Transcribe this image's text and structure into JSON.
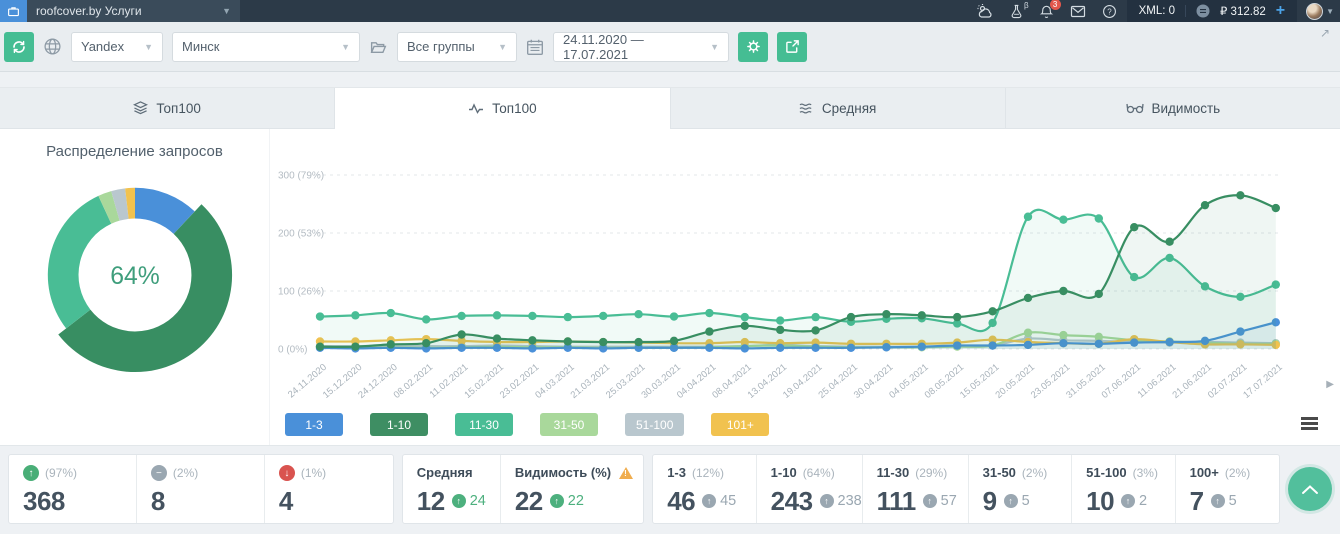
{
  "topbar": {
    "project": "roofcover.by Услуги",
    "bell_badge": "3",
    "xml_label": "XML: 0",
    "balance": "₽ 312.82",
    "plus": "+"
  },
  "toolbar": {
    "engine": "Yandex",
    "region": "Минск",
    "group": "Все группы",
    "date_range": "24.11.2020 — 17.07.2021"
  },
  "tabs": [
    {
      "label": "Топ100"
    },
    {
      "label": "Топ100",
      "active": true
    },
    {
      "label": "Средняя"
    },
    {
      "label": "Видимость"
    }
  ],
  "colors": {
    "blue": "#4a90d9",
    "darkgreen": "#388e62",
    "teal": "#49bd95",
    "lightgreen": "#a9d89b",
    "gray": "#b9c7ce",
    "yellow": "#f1c24f"
  },
  "legend": {
    "items": [
      {
        "label": "1-3",
        "color": "#4a90d9"
      },
      {
        "label": "1-10",
        "color": "#3e8e63"
      },
      {
        "label": "11-30",
        "color": "#49bd95"
      },
      {
        "label": "31-50",
        "color": "#a9d89b"
      },
      {
        "label": "51-100",
        "color": "#b9c7ce"
      },
      {
        "label": "101+",
        "color": "#f1c24f"
      }
    ]
  },
  "chart_data": [
    {
      "type": "pie",
      "title": "Распределение запросов",
      "center_label": "64%",
      "center_color": "#3f9e7c",
      "segments": [
        {
          "label": "1-3",
          "pct": 12.0,
          "color": "#4a90d9",
          "exploded": false
        },
        {
          "label": "1-10",
          "pct": 52.5,
          "color": "#388e62",
          "exploded": true
        },
        {
          "label": "11-30",
          "pct": 28.6,
          "color": "#49bd95",
          "exploded": false
        },
        {
          "label": "31-50",
          "pct": 2.5,
          "color": "#a9d89b",
          "exploded": false
        },
        {
          "label": "51-100",
          "pct": 2.6,
          "color": "#b9c7ce",
          "exploded": false
        },
        {
          "label": "101+",
          "pct": 1.8,
          "color": "#f1c24f",
          "exploded": false
        }
      ]
    },
    {
      "type": "line",
      "ylim": [
        0,
        300
      ],
      "grid": true,
      "yticks": [
        {
          "v": 0,
          "label": "0 (0%)"
        },
        {
          "v": 100,
          "label": "100 (26%)"
        },
        {
          "v": 200,
          "label": "200 (53%)"
        },
        {
          "v": 300,
          "label": "300 (79%)"
        }
      ],
      "x": [
        "24.11.2020",
        "15.12.2020",
        "24.12.2020",
        "08.02.2021",
        "11.02.2021",
        "15.02.2021",
        "23.02.2021",
        "04.03.2021",
        "21.03.2021",
        "25.03.2021",
        "30.03.2021",
        "04.04.2021",
        "08.04.2021",
        "13.04.2021",
        "19.04.2021",
        "25.04.2021",
        "30.04.2021",
        "04.05.2021",
        "08.05.2021",
        "15.05.2021",
        "20.05.2021",
        "23.05.2021",
        "31.05.2021",
        "07.06.2021",
        "11.06.2021",
        "21.06.2021",
        "02.07.2021",
        "17.07.2021"
      ],
      "series": [
        {
          "name": "51-100",
          "color": "#b9c7ce",
          "fill": false,
          "values": [
            5,
            5,
            6,
            5,
            5,
            6,
            5,
            4,
            4,
            4,
            4,
            4,
            5,
            7,
            5,
            4,
            4,
            4,
            5,
            6,
            18,
            15,
            14,
            12,
            11,
            12,
            11,
            10
          ]
        },
        {
          "name": "31-50",
          "color": "#a9d89b",
          "fill": false,
          "values": [
            3,
            2,
            3,
            2,
            3,
            4,
            3,
            3,
            2,
            2,
            2,
            3,
            5,
            6,
            4,
            3,
            3,
            3,
            4,
            6,
            28,
            24,
            21,
            15,
            13,
            11,
            9,
            9
          ]
        },
        {
          "name": "101+",
          "color": "#f1c24f",
          "fill": false,
          "values": [
            13,
            13,
            15,
            17,
            14,
            12,
            12,
            13,
            12,
            11,
            10,
            10,
            12,
            10,
            11,
            9,
            9,
            9,
            11,
            16,
            12,
            10,
            9,
            17,
            12,
            8,
            8,
            7
          ]
        },
        {
          "name": "1-3",
          "color": "#4a90d9",
          "fill": true,
          "values": [
            2,
            1,
            2,
            1,
            2,
            2,
            1,
            2,
            1,
            2,
            2,
            2,
            1,
            2,
            2,
            2,
            3,
            4,
            6,
            6,
            7,
            10,
            9,
            11,
            12,
            14,
            30,
            46
          ]
        },
        {
          "name": "11-30",
          "color": "#49bd95",
          "fill": true,
          "values": [
            56,
            58,
            62,
            51,
            57,
            58,
            57,
            55,
            57,
            60,
            56,
            62,
            55,
            49,
            55,
            47,
            52,
            53,
            44,
            45,
            228,
            223,
            225,
            124,
            157,
            108,
            90,
            111
          ]
        },
        {
          "name": "1-10",
          "color": "#388e62",
          "fill": true,
          "values": [
            4,
            4,
            8,
            10,
            25,
            18,
            15,
            13,
            12,
            12,
            14,
            30,
            40,
            33,
            32,
            55,
            60,
            58,
            55,
            65,
            88,
            100,
            95,
            210,
            185,
            248,
            265,
            243
          ]
        }
      ]
    }
  ],
  "stats": {
    "group1": [
      {
        "pct": "(97%)",
        "value": "368"
      },
      {
        "pct": "(2%)",
        "value": "8"
      },
      {
        "pct": "(1%)",
        "value": "4"
      }
    ],
    "group2": [
      {
        "label": "Средняя",
        "value": "12",
        "delta": "24"
      },
      {
        "label": "Видимость (%)",
        "value": "22",
        "delta": "22"
      }
    ],
    "group3": [
      {
        "label": "1-3",
        "pct": "(12%)",
        "value": "46",
        "delta": "45"
      },
      {
        "label": "1-10",
        "pct": "(64%)",
        "value": "243",
        "delta": "238"
      },
      {
        "label": "11-30",
        "pct": "(29%)",
        "value": "111",
        "delta": "57"
      },
      {
        "label": "31-50",
        "pct": "(2%)",
        "value": "9",
        "delta": "5"
      },
      {
        "label": "51-100",
        "pct": "(3%)",
        "value": "10",
        "delta": "2"
      },
      {
        "label": "100+",
        "pct": "(2%)",
        "value": "7",
        "delta": "5"
      }
    ]
  }
}
